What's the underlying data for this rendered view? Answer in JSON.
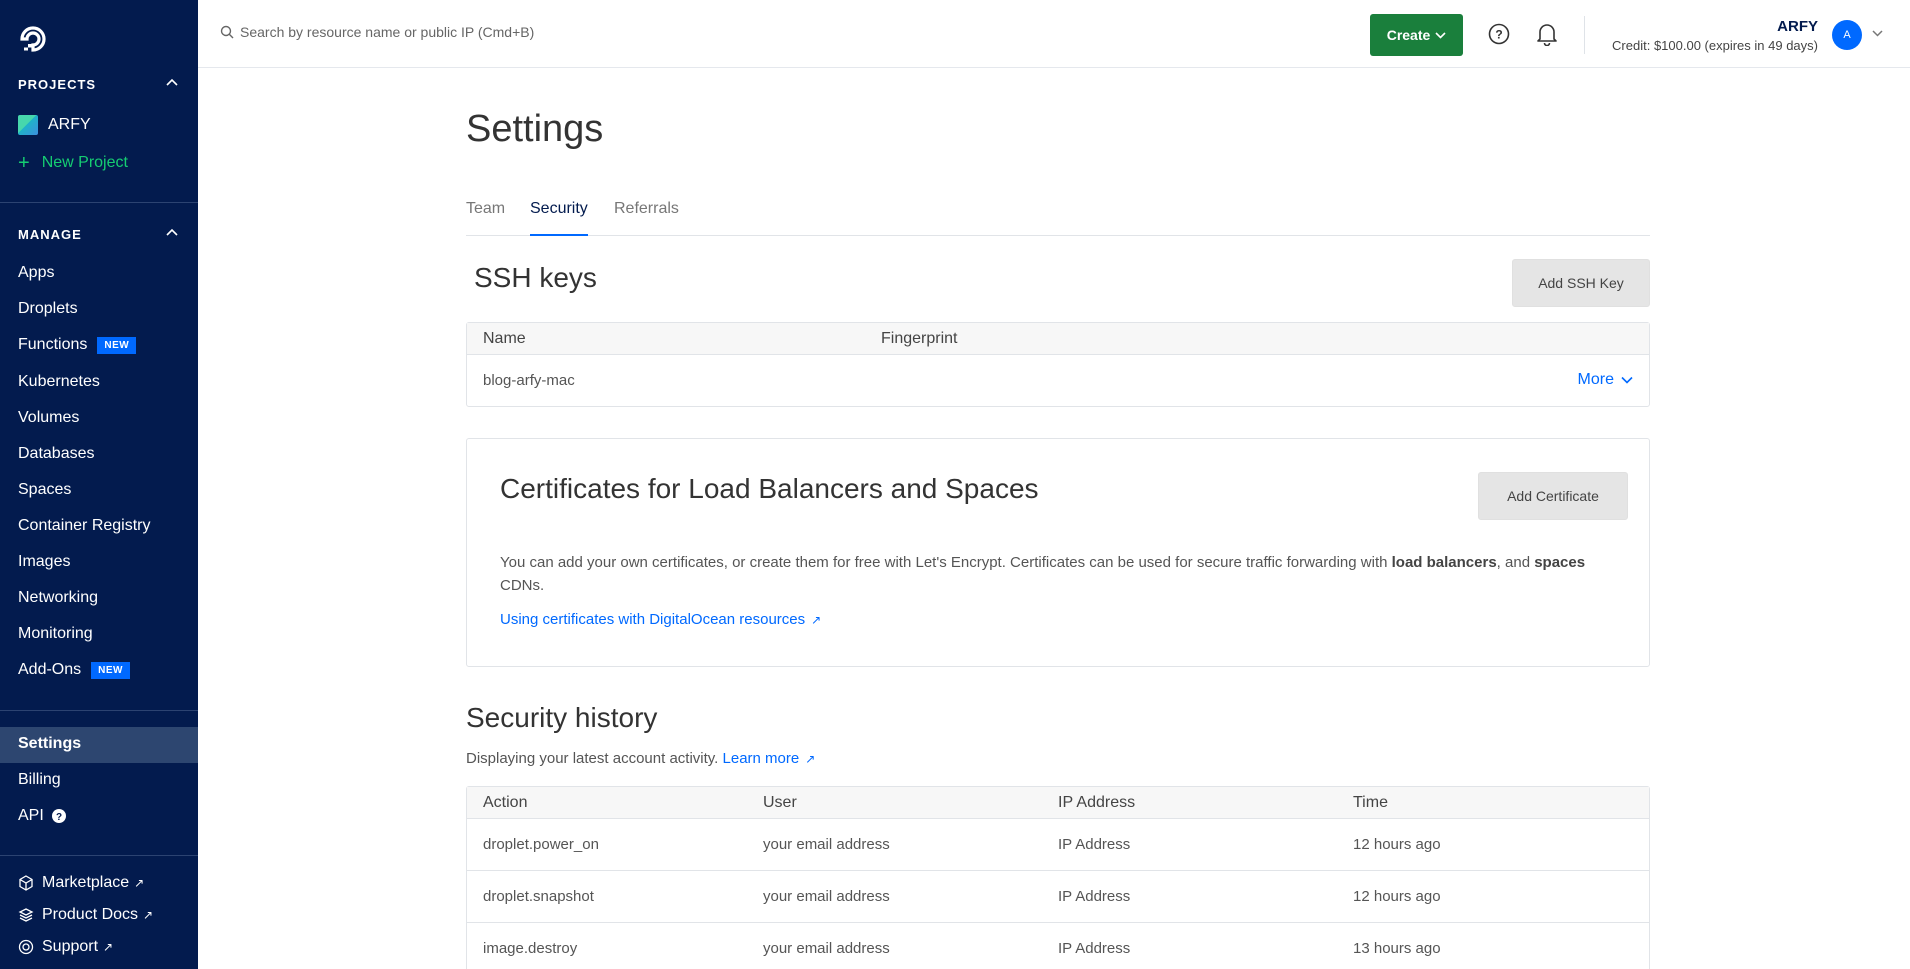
{
  "sidebar": {
    "projects_title": "PROJECTS",
    "project_name": "ARFY",
    "new_project": "New Project",
    "manage_title": "MANAGE",
    "manage_items": [
      {
        "label": "Apps"
      },
      {
        "label": "Droplets"
      },
      {
        "label": "Functions",
        "badge": "NEW"
      },
      {
        "label": "Kubernetes"
      },
      {
        "label": "Volumes"
      },
      {
        "label": "Databases"
      },
      {
        "label": "Spaces"
      },
      {
        "label": "Container Registry"
      },
      {
        "label": "Images"
      },
      {
        "label": "Networking"
      },
      {
        "label": "Monitoring"
      },
      {
        "label": "Add-Ons",
        "badge": "NEW"
      }
    ],
    "account_items": [
      {
        "label": "Settings"
      },
      {
        "label": "Billing"
      },
      {
        "label": "API"
      }
    ],
    "bottom_items": [
      {
        "label": "Marketplace",
        "icon": "marketplace-icon"
      },
      {
        "label": "Product Docs",
        "icon": "docs-icon"
      },
      {
        "label": "Support",
        "icon": "support-icon"
      }
    ]
  },
  "topbar": {
    "search_placeholder": "Search by resource name or public IP (Cmd+B)",
    "create_label": "Create",
    "account_name": "ARFY",
    "credit": "Credit: $100.00 (expires in 49 days)",
    "avatar_initial": "A"
  },
  "page": {
    "title": "Settings",
    "tabs": [
      "Team",
      "Security",
      "Referrals"
    ],
    "active_tab": "Security"
  },
  "ssh": {
    "title": "SSH keys",
    "add_button": "Add SSH Key",
    "columns": [
      "Name",
      "Fingerprint"
    ],
    "rows": [
      {
        "name": "blog-arfy-mac",
        "fingerprint": "",
        "action": "More"
      }
    ]
  },
  "certificates": {
    "title": "Certificates for Load Balancers and Spaces",
    "add_button": "Add Certificate",
    "desc_1": "You can add your own certificates, or create them for free with Let's Encrypt. Certificates can be used for secure traffic forwarding with ",
    "desc_bold_1": "load balancers",
    "desc_2": ", and ",
    "desc_bold_2": "spaces",
    "desc_3": " CDNs.",
    "link": "Using certificates with DigitalOcean resources"
  },
  "security_history": {
    "title": "Security history",
    "desc": "Displaying your latest account activity.",
    "learn_more": "Learn more",
    "columns": [
      "Action",
      "User",
      "IP Address",
      "Time"
    ],
    "rows": [
      [
        "droplet.power_on",
        "your email address",
        "IP Address",
        "12 hours ago"
      ],
      [
        "droplet.snapshot",
        "your email address",
        "IP Address",
        "12 hours ago"
      ],
      [
        "image.destroy",
        "your email address",
        "IP Address",
        "13 hours ago"
      ]
    ]
  },
  "colors": {
    "sidebar_bg": "#031b4e",
    "accent_blue": "#0069ff",
    "create_green": "#1a7f3c",
    "new_project_green": "#15cd72"
  }
}
